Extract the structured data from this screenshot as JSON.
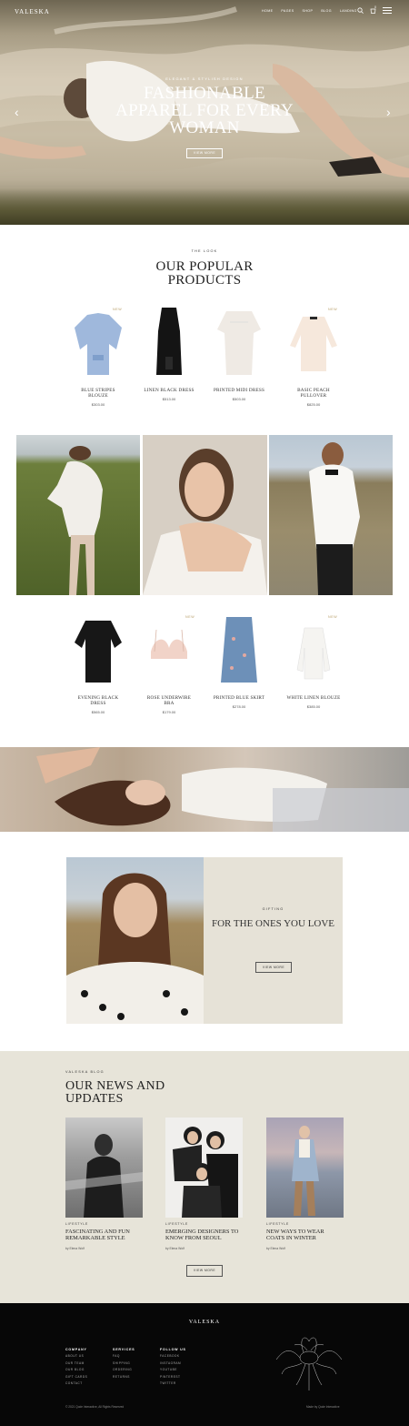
{
  "nav": {
    "logo": "VALESKA",
    "links": [
      "HOME",
      "PAGES",
      "SHOP",
      "BLOG",
      "LANDING"
    ],
    "cart_count": "0"
  },
  "hero": {
    "eyebrow": "ELEGANT & STYLISH DESIGN",
    "title": "FASHIONABLE APPAREL FOR EVERY WOMAN",
    "button": "VIEW MORE",
    "prev_arrow": "‹",
    "next_arrow": "›"
  },
  "popular": {
    "eyebrow": "THE LOOK",
    "title": "OUR POPULAR PRODUCTS",
    "products_row1": [
      {
        "name": "BLUE STRIPES BLOUZE",
        "price": "$303.00",
        "badge": "NEW"
      },
      {
        "name": "LINEN BLACK DRESS",
        "price": "$513.00",
        "badge": ""
      },
      {
        "name": "PRINTED MIDI DRESS",
        "price": "$503.00",
        "badge": ""
      },
      {
        "name": "BASIC PEACH PULLOVER",
        "price": "$825.00",
        "badge": "NEW"
      }
    ],
    "products_row2": [
      {
        "name": "EVENING BLACK DRESS",
        "price": "$565.00",
        "badge": ""
      },
      {
        "name": "ROSE UNDERWIRE BRA",
        "price": "$179.00",
        "badge": "NEW"
      },
      {
        "name": "PRINTED BLUE SKIRT",
        "price": "$278.00",
        "badge": ""
      },
      {
        "name": "WHITE LINEN BLOUZE",
        "price": "$385.00",
        "badge": "NEW"
      }
    ]
  },
  "gift": {
    "eyebrow": "GIFTING",
    "title": "FOR THE ONES YOU LOVE",
    "button": "VIEW MORE"
  },
  "news": {
    "eyebrow": "VALESKA BLOG",
    "title": "OUR NEWS AND UPDATES",
    "button": "VIEW MORE",
    "posts": [
      {
        "category": "LIFESTYLE",
        "title": "FASCINATING AND FUN REMARKABLE STYLE",
        "author": "by Elena Wolf"
      },
      {
        "category": "LIFESTYLE",
        "title": "EMERGING DESIGNERS TO KNOW FROM SEOUL",
        "author": "by Elena Wolf"
      },
      {
        "category": "LIFESTYLE",
        "title": "NEW WAYS TO WEAR COATS IN WINTER",
        "author": "by Elena Wolf"
      }
    ]
  },
  "footer": {
    "logo": "VALESKA",
    "columns": [
      {
        "title": "COMPANY",
        "items": [
          "ABOUT US",
          "OUR TEAM",
          "OUR BLOG",
          "GIFT CARDS",
          "CONTACT"
        ]
      },
      {
        "title": "SERVICES",
        "items": [
          "FAQ",
          "SHIPPING",
          "ORDERING",
          "RETURNS"
        ]
      },
      {
        "title": "FOLLOW US",
        "items": [
          "FACEBOOK",
          "INSTAGRAM",
          "YOUTUBE",
          "PINTEREST",
          "TWITTER"
        ]
      }
    ],
    "copyright": "© 2021 Qode Interactive, All Rights Reserved",
    "made_by": "Made by Qode Interactive"
  },
  "colors": {
    "accent": "#b69c66",
    "beige": "#e7e4d9",
    "footer": "#070707"
  }
}
